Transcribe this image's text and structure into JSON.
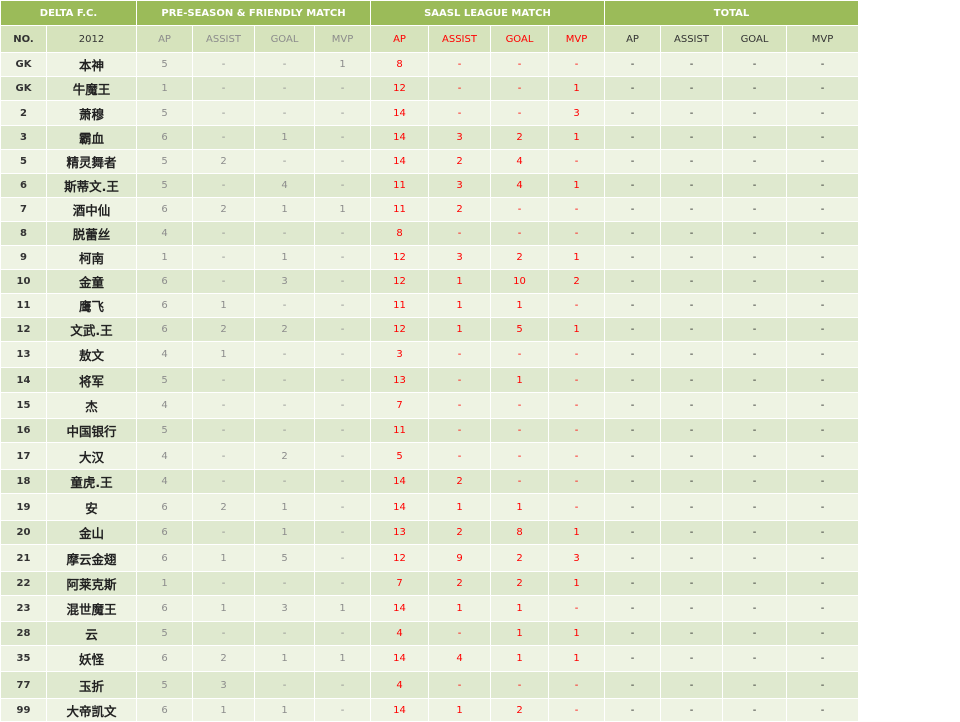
{
  "header": {
    "team": "DELTA F.C.",
    "group_pre": "PRE-SEASON & FRIENDLY MATCH",
    "group_league": "SAASL LEAGUE MATCH",
    "group_total": "TOTAL",
    "col_no": "NO.",
    "col_year": "2012",
    "pre_cols": [
      "AP",
      "ASSIST",
      "GOAL",
      "MVP"
    ],
    "league_cols": [
      "AP",
      "ASSIST",
      "GOAL",
      "MVP"
    ],
    "total_cols": [
      "AP",
      "ASSIST",
      "GOAL",
      "MVP"
    ]
  },
  "rows": [
    {
      "no": "GK",
      "name": "本神",
      "pre": [
        "5",
        "-",
        "-",
        "1"
      ],
      "league": [
        "8",
        "-",
        "-",
        "-"
      ],
      "total": [
        "-",
        "-",
        "-",
        "-"
      ]
    },
    {
      "no": "GK",
      "name": "牛魔王",
      "pre": [
        "1",
        "-",
        "-",
        "-"
      ],
      "league": [
        "12",
        "-",
        "-",
        "1"
      ],
      "total": [
        "-",
        "-",
        "-",
        "-"
      ]
    },
    {
      "no": "2",
      "name": "萧穆",
      "pre": [
        "5",
        "-",
        "-",
        "-"
      ],
      "league": [
        "14",
        "-",
        "-",
        "3"
      ],
      "total": [
        "-",
        "-",
        "-",
        "-"
      ]
    },
    {
      "no": "3",
      "name": "霸血",
      "pre": [
        "6",
        "-",
        "1",
        "-"
      ],
      "league": [
        "14",
        "3",
        "2",
        "1"
      ],
      "total": [
        "-",
        "-",
        "-",
        "-"
      ]
    },
    {
      "no": "5",
      "name": "精灵舞者",
      "pre": [
        "5",
        "2",
        "-",
        "-"
      ],
      "league": [
        "14",
        "2",
        "4",
        "-"
      ],
      "total": [
        "-",
        "-",
        "-",
        "-"
      ]
    },
    {
      "no": "6",
      "name": "斯蒂文.王",
      "pre": [
        "5",
        "-",
        "4",
        "-"
      ],
      "league": [
        "11",
        "3",
        "4",
        "1"
      ],
      "total": [
        "-",
        "-",
        "-",
        "-"
      ]
    },
    {
      "no": "7",
      "name": "酒中仙",
      "pre": [
        "6",
        "2",
        "1",
        "1"
      ],
      "league": [
        "11",
        "2",
        "-",
        "-"
      ],
      "total": [
        "-",
        "-",
        "-",
        "-"
      ]
    },
    {
      "no": "8",
      "name": "脱蕾丝",
      "pre": [
        "4",
        "-",
        "-",
        "-"
      ],
      "league": [
        "8",
        "-",
        "-",
        "-"
      ],
      "total": [
        "-",
        "-",
        "-",
        "-"
      ]
    },
    {
      "no": "9",
      "name": "柯南",
      "pre": [
        "1",
        "-",
        "1",
        "-"
      ],
      "league": [
        "12",
        "3",
        "2",
        "1"
      ],
      "total": [
        "-",
        "-",
        "-",
        "-"
      ]
    },
    {
      "no": "10",
      "name": "金童",
      "pre": [
        "6",
        "-",
        "3",
        "-"
      ],
      "league": [
        "12",
        "1",
        "10",
        "2"
      ],
      "total": [
        "-",
        "-",
        "-",
        "-"
      ]
    },
    {
      "no": "11",
      "name": "鹰飞",
      "pre": [
        "6",
        "1",
        "-",
        "-"
      ],
      "league": [
        "11",
        "1",
        "1",
        "-"
      ],
      "total": [
        "-",
        "-",
        "-",
        "-"
      ]
    },
    {
      "no": "12",
      "name": "文武.王",
      "pre": [
        "6",
        "2",
        "2",
        "-"
      ],
      "league": [
        "12",
        "1",
        "5",
        "1"
      ],
      "total": [
        "-",
        "-",
        "-",
        "-"
      ]
    },
    {
      "no": "13",
      "name": "敖文",
      "pre": [
        "4",
        "1",
        "-",
        "-"
      ],
      "league": [
        "3",
        "-",
        "-",
        "-"
      ],
      "total": [
        "-",
        "-",
        "-",
        "-"
      ]
    },
    {
      "no": "14",
      "name": "将军",
      "pre": [
        "5",
        "-",
        "-",
        "-"
      ],
      "league": [
        "13",
        "-",
        "1",
        "-"
      ],
      "total": [
        "-",
        "-",
        "-",
        "-"
      ]
    },
    {
      "no": "15",
      "name": "杰",
      "pre": [
        "4",
        "-",
        "-",
        "-"
      ],
      "league": [
        "7",
        "-",
        "-",
        "-"
      ],
      "total": [
        "-",
        "-",
        "-",
        "-"
      ]
    },
    {
      "no": "16",
      "name": "中国银行",
      "pre": [
        "5",
        "-",
        "-",
        "-"
      ],
      "league": [
        "11",
        "-",
        "-",
        "-"
      ],
      "total": [
        "-",
        "-",
        "-",
        "-"
      ]
    },
    {
      "no": "17",
      "name": "大汉",
      "pre": [
        "4",
        "-",
        "2",
        "-"
      ],
      "league": [
        "5",
        "-",
        "-",
        "-"
      ],
      "total": [
        "-",
        "-",
        "-",
        "-"
      ]
    },
    {
      "no": "18",
      "name": "童虎.王",
      "pre": [
        "4",
        "-",
        "-",
        "-"
      ],
      "league": [
        "14",
        "2",
        "-",
        "-"
      ],
      "total": [
        "-",
        "-",
        "-",
        "-"
      ]
    },
    {
      "no": "19",
      "name": "安",
      "pre": [
        "6",
        "2",
        "1",
        "-"
      ],
      "league": [
        "14",
        "1",
        "1",
        "-"
      ],
      "total": [
        "-",
        "-",
        "-",
        "-"
      ]
    },
    {
      "no": "20",
      "name": "金山",
      "pre": [
        "6",
        "-",
        "1",
        "-"
      ],
      "league": [
        "13",
        "2",
        "8",
        "1"
      ],
      "total": [
        "-",
        "-",
        "-",
        "-"
      ]
    },
    {
      "no": "21",
      "name": "摩云金翅",
      "pre": [
        "6",
        "1",
        "5",
        "-"
      ],
      "league": [
        "12",
        "9",
        "2",
        "3"
      ],
      "total": [
        "-",
        "-",
        "-",
        "-"
      ]
    },
    {
      "no": "22",
      "name": "阿莱克斯",
      "pre": [
        "1",
        "-",
        "-",
        "-"
      ],
      "league": [
        "7",
        "2",
        "2",
        "1"
      ],
      "total": [
        "-",
        "-",
        "-",
        "-"
      ]
    },
    {
      "no": "23",
      "name": "混世魔王",
      "pre": [
        "6",
        "1",
        "3",
        "1"
      ],
      "league": [
        "14",
        "1",
        "1",
        "-"
      ],
      "total": [
        "-",
        "-",
        "-",
        "-"
      ]
    },
    {
      "no": "28",
      "name": "云",
      "pre": [
        "5",
        "-",
        "-",
        "-"
      ],
      "league": [
        "4",
        "-",
        "1",
        "1"
      ],
      "total": [
        "-",
        "-",
        "-",
        "-"
      ]
    },
    {
      "no": "35",
      "name": "妖怪",
      "pre": [
        "6",
        "2",
        "1",
        "1"
      ],
      "league": [
        "14",
        "4",
        "1",
        "1"
      ],
      "total": [
        "-",
        "-",
        "-",
        "-"
      ]
    },
    {
      "no": "77",
      "name": "玉折",
      "pre": [
        "5",
        "3",
        "-",
        "-"
      ],
      "league": [
        "4",
        "-",
        "-",
        "-"
      ],
      "total": [
        "-",
        "-",
        "-",
        "-"
      ]
    },
    {
      "no": "99",
      "name": "大帝凯文",
      "pre": [
        "6",
        "1",
        "1",
        "-"
      ],
      "league": [
        "14",
        "1",
        "2",
        "-"
      ],
      "total": [
        "-",
        "-",
        "-",
        "-"
      ]
    }
  ],
  "colors": {
    "header_green": "#9bbb59",
    "subheader_green": "#d6e3bc",
    "row_light": "#eef3e3",
    "row_dark": "#dfe9cf",
    "league_red": "#ff0000",
    "pre_grey": "#8c8c8c"
  }
}
